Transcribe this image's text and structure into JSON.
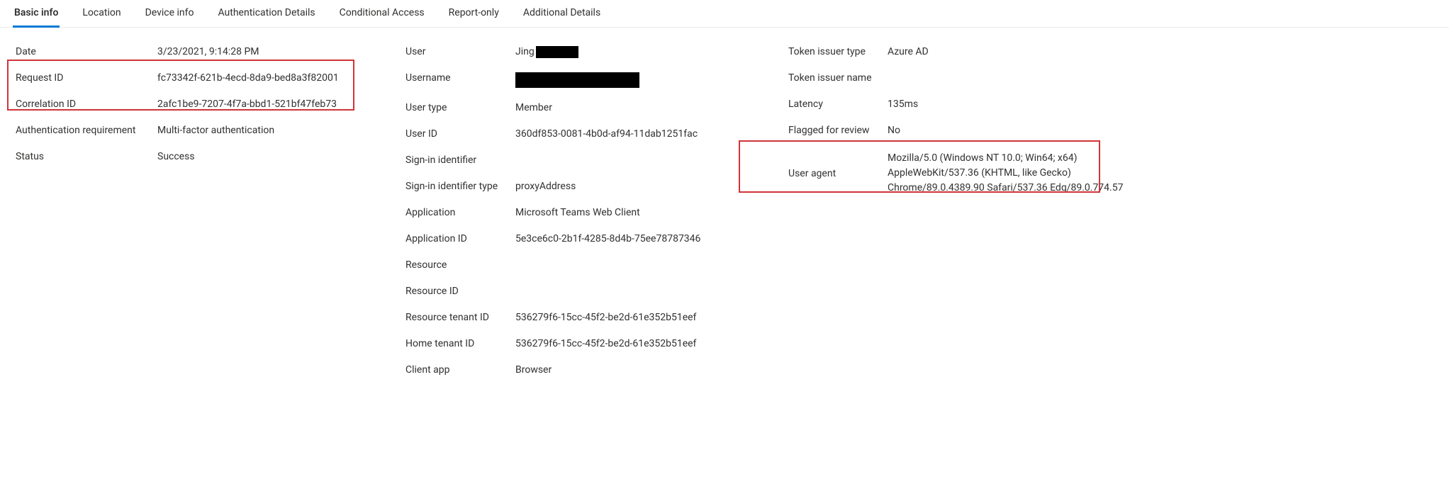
{
  "tabs": {
    "basic_info": "Basic info",
    "location": "Location",
    "device_info": "Device info",
    "auth_details": "Authentication Details",
    "conditional_access": "Conditional Access",
    "report_only": "Report-only",
    "additional_details": "Additional Details"
  },
  "col1": {
    "date": {
      "label": "Date",
      "value": "3/23/2021, 9:14:28 PM"
    },
    "request_id": {
      "label": "Request ID",
      "value": "fc73342f-621b-4ecd-8da9-bed8a3f82001"
    },
    "correlation_id": {
      "label": "Correlation ID",
      "value": "2afc1be9-7207-4f7a-bbd1-521bf47feb73"
    },
    "auth_req": {
      "label": "Authentication requirement",
      "value": "Multi-factor authentication"
    },
    "status": {
      "label": "Status",
      "value": "Success"
    }
  },
  "col2": {
    "user": {
      "label": "User",
      "value": "Jing"
    },
    "username": {
      "label": "Username"
    },
    "user_type": {
      "label": "User type",
      "value": "Member"
    },
    "user_id": {
      "label": "User ID",
      "value": "360df853-0081-4b0d-af94-11dab1251fac"
    },
    "signin_identifier": {
      "label": "Sign-in identifier",
      "value": ""
    },
    "signin_identifier_type": {
      "label": "Sign-in identifier type",
      "value": "proxyAddress"
    },
    "application": {
      "label": "Application",
      "value": "Microsoft Teams Web Client"
    },
    "application_id": {
      "label": "Application ID",
      "value": "5e3ce6c0-2b1f-4285-8d4b-75ee78787346"
    },
    "resource": {
      "label": "Resource",
      "value": ""
    },
    "resource_id": {
      "label": "Resource ID",
      "value": ""
    },
    "resource_tenant_id": {
      "label": "Resource tenant ID",
      "value": "536279f6-15cc-45f2-be2d-61e352b51eef"
    },
    "home_tenant_id": {
      "label": "Home tenant ID",
      "value": "536279f6-15cc-45f2-be2d-61e352b51eef"
    },
    "client_app": {
      "label": "Client app",
      "value": "Browser"
    }
  },
  "col3": {
    "token_issuer_type": {
      "label": "Token issuer type",
      "value": "Azure AD"
    },
    "token_issuer_name": {
      "label": "Token issuer name",
      "value": ""
    },
    "latency": {
      "label": "Latency",
      "value": "135ms"
    },
    "flagged": {
      "label": "Flagged for review",
      "value": "No"
    },
    "user_agent": {
      "label": "User agent",
      "value": "Mozilla/5.0 (Windows NT 10.0; Win64; x64) AppleWebKit/537.36 (KHTML, like Gecko) Chrome/89.0.4389.90 Safari/537.36 Edg/89.0.774.57"
    }
  }
}
